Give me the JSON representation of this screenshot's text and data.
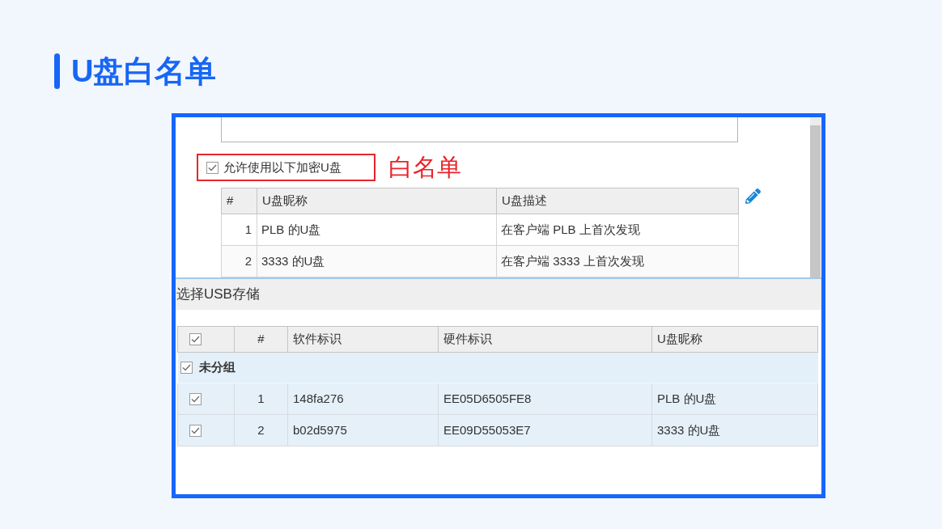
{
  "title": "U盘白名单",
  "whitelist_panel": {
    "allow_checkbox": {
      "label": "允许使用以下加密U盘",
      "checked": true
    },
    "annotation": "白名单",
    "table": {
      "columns": [
        "#",
        "U盘昵称",
        "U盘描述"
      ],
      "rows": [
        {
          "index": "1",
          "nickname": "PLB 的U盘",
          "description": "在客户端 PLB 上首次发现"
        },
        {
          "index": "2",
          "nickname": "3333 的U盘",
          "description": "在客户端 3333 上首次发现"
        }
      ]
    }
  },
  "usb_storage_panel": {
    "title": "选择USB存储",
    "table": {
      "header_checked": true,
      "columns": [
        "#",
        "软件标识",
        "硬件标识",
        "U盘昵称"
      ],
      "groups": [
        {
          "name": "未分组",
          "checked": true,
          "rows": [
            {
              "checked": true,
              "index": "1",
              "software_id": "148fa276",
              "hardware_id": "EE05D6505FE8",
              "nickname": "PLB 的U盘"
            },
            {
              "checked": true,
              "index": "2",
              "software_id": "b02d5975",
              "hardware_id": "EE09D55053E7",
              "nickname": "3333 的U盘"
            }
          ]
        }
      ]
    }
  }
}
